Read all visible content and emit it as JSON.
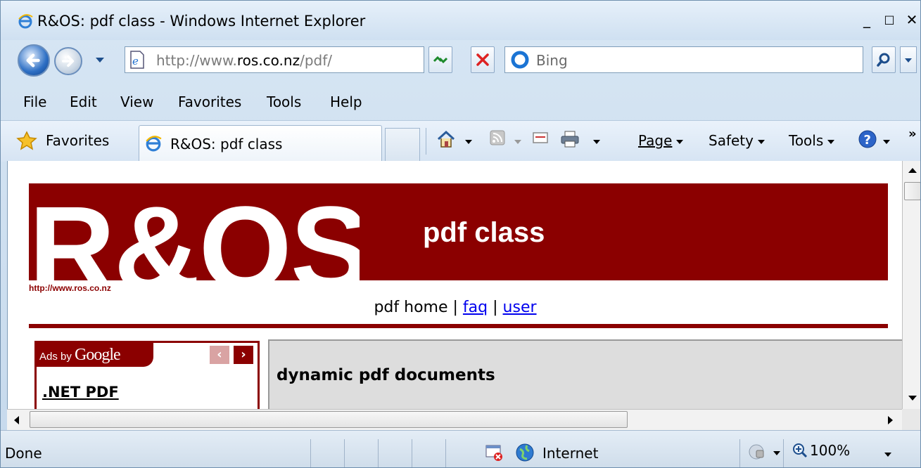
{
  "window": {
    "title": "R&OS: pdf class - Windows Internet Explorer",
    "controls": {
      "minimize": "_",
      "maximize": "□",
      "close": "✕"
    }
  },
  "address_bar": {
    "url_prefix": "http://www.",
    "url_domain": "ros.co.nz",
    "url_suffix": "/pdf/"
  },
  "search": {
    "placeholder": "Bing"
  },
  "menu": [
    "File",
    "Edit",
    "View",
    "Favorites",
    "Tools",
    "Help"
  ],
  "favorites_bar": {
    "favorites_label": "Favorites",
    "tab_title": "R&OS: pdf class",
    "commands": {
      "page": "Page",
      "safety": "Safety",
      "tools": "Tools"
    },
    "overflow": "»"
  },
  "page": {
    "logo_text": "R&OS",
    "logo_url": "http://www.ros.co.nz",
    "banner_title": "pdf class",
    "subnav": {
      "home": "pdf home",
      "sep": "|",
      "faq": "faq",
      "user": "user"
    },
    "ads": {
      "label_prefix": "Ads by",
      "label_brand": "Google",
      "prev": "‹",
      "next": "›",
      "first_link": ".NET PDF"
    },
    "main_heading": "dynamic pdf documents"
  },
  "status_bar": {
    "status": "Done",
    "zone": "Internet",
    "zoom": "100%"
  },
  "colors": {
    "brand_red": "#8b0000",
    "link": "#0000ee",
    "chrome": "#d0e0f0"
  },
  "icons": [
    "ie-logo-icon",
    "back-arrow-icon",
    "forward-arrow-icon",
    "page-icon",
    "refresh-icon",
    "stop-icon",
    "bing-icon",
    "search-icon",
    "favorites-star-icon",
    "home-icon",
    "feeds-icon",
    "read-mail-icon",
    "print-icon",
    "help-icon",
    "popup-blocked-icon",
    "globe-icon",
    "protected-mode-icon",
    "zoom-icon"
  ]
}
